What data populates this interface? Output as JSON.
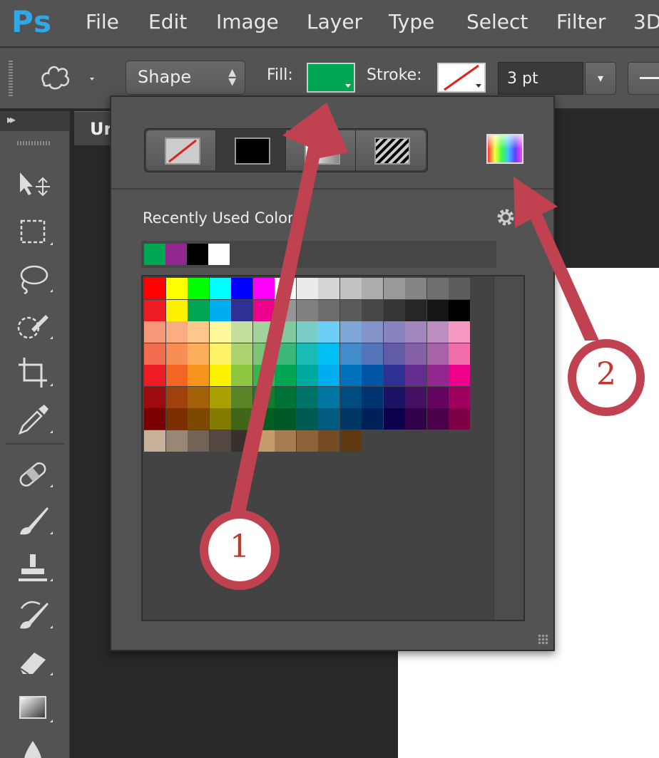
{
  "app": {
    "logo": "Ps"
  },
  "menu": [
    "File",
    "Edit",
    "Image",
    "Layer",
    "Type",
    "Select",
    "Filter",
    "3D"
  ],
  "options_bar": {
    "mode_label": "Shape",
    "fill_label": "Fill:",
    "fill_color": "#00a651",
    "stroke_label": "Stroke:",
    "stroke_width": "3 pt"
  },
  "toolbar": {
    "tools": [
      "move-tool-icon",
      "marquee-tool-icon",
      "lasso-tool-icon",
      "quick-selection-tool-icon",
      "crop-tool-icon",
      "eyedropper-tool-icon",
      "healing-brush-tool-icon",
      "brush-tool-icon",
      "clone-stamp-tool-icon",
      "history-brush-tool-icon",
      "eraser-tool-icon",
      "gradient-tool-icon",
      "blur-tool-icon"
    ]
  },
  "document": {
    "tab_title": "Ur"
  },
  "panel": {
    "fill_types": [
      "no-color",
      "solid-color",
      "gradient",
      "pattern"
    ],
    "recent_label": "Recently Used Colors",
    "recent_colors": [
      "#00a651",
      "#92278f",
      "#000000",
      "#ffffff"
    ],
    "swatch_rows": [
      [
        "#ff0000",
        "#ffff00",
        "#00ff00",
        "#00ffff",
        "#0000ff",
        "#ff00ff",
        "#ffffff",
        "#ebebeb",
        "#d6d6d6",
        "#c2c2c2",
        "#adadad",
        "#999999",
        "#858585",
        "#707070",
        "#5c5c5c"
      ],
      [
        "#ed1c24",
        "#fff200",
        "#00a651",
        "#00aeef",
        "#2e3192",
        "#ec008c",
        "#959595",
        "#808080",
        "#6d6d6d",
        "#5a5a5a",
        "#474747",
        "#363636",
        "#262626",
        "#161616",
        "#000000"
      ],
      [
        "#f7977a",
        "#f9ad81",
        "#fdc68a",
        "#fff79a",
        "#c4df9b",
        "#a3d39c",
        "#82ca9d",
        "#7bcdc8",
        "#6ecff6",
        "#7ea7d8",
        "#8493ca",
        "#8882be",
        "#a187be",
        "#bc8dbf",
        "#f49ac2"
      ],
      [
        "#f26c4f",
        "#f68e55",
        "#fbaf5c",
        "#fff467",
        "#acd372",
        "#7cc576",
        "#3bb878",
        "#1abbb4",
        "#00bff3",
        "#438ccb",
        "#5574b9",
        "#605ca8",
        "#855fa8",
        "#a763a8",
        "#f06ea9"
      ],
      [
        "#ed1c24",
        "#f26522",
        "#f7941d",
        "#fff200",
        "#8dc63f",
        "#39b54a",
        "#00a651",
        "#00a99d",
        "#00aeef",
        "#0072bc",
        "#0054a6",
        "#2e3192",
        "#662d91",
        "#92278f",
        "#ec008c"
      ],
      [
        "#9e0b0f",
        "#a0410d",
        "#a36209",
        "#aba000",
        "#598527",
        "#197b30",
        "#007236",
        "#00746b",
        "#0076a3",
        "#004b80",
        "#003471",
        "#1b1464",
        "#440e62",
        "#630460",
        "#9e005d"
      ],
      [
        "#790000",
        "#7b2e00",
        "#7d4900",
        "#827b00",
        "#406618",
        "#005e20",
        "#005826",
        "#005952",
        "#005b7f",
        "#003663",
        "#002157",
        "#0d004c",
        "#32004b",
        "#4b0049",
        "#7b0046"
      ],
      [
        "#c7b299",
        "#998675",
        "#736357",
        "#534741",
        "#37302d",
        "#c69c6d",
        "#a67c52",
        "#8c6239",
        "#754c24",
        "#603913"
      ]
    ]
  },
  "callouts": [
    "1",
    "2"
  ],
  "colors": {
    "callout": "#c0414f"
  }
}
